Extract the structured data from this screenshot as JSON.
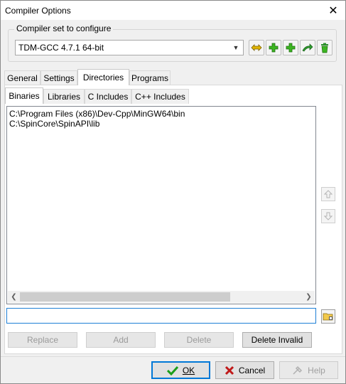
{
  "window": {
    "title": "Compiler Options",
    "close_glyph": "✕"
  },
  "compiler_group": {
    "legend": "Compiler set to configure",
    "selected": "TDM-GCC 4.7.1 64-bit",
    "icons": [
      "rename-icon",
      "add-icon",
      "add-folder-icon",
      "arrow-icon",
      "delete-icon"
    ]
  },
  "main_tabs": [
    {
      "label": "General"
    },
    {
      "label": "Settings"
    },
    {
      "label": "Directories"
    },
    {
      "label": "Programs"
    }
  ],
  "sub_tabs": [
    {
      "label": "Binaries"
    },
    {
      "label": "Libraries"
    },
    {
      "label": "C Includes"
    },
    {
      "label": "C++ Includes"
    }
  ],
  "list": {
    "items": [
      "C:\\Program Files (x86)\\Dev-Cpp\\MinGW64\\bin",
      "C:\\SpinCore\\SpinAPI\\lib"
    ]
  },
  "input": {
    "value": ""
  },
  "buttons": {
    "replace": "Replace",
    "add": "Add",
    "delete": "Delete",
    "delete_invalid": "Delete Invalid"
  },
  "dialog": {
    "ok_label": "OK",
    "cancel_label": "Cancel",
    "help_label": "Help"
  },
  "colors": {
    "accent": "#0078d7",
    "ok_check": "#1a9e1a",
    "cancel_x": "#c01818"
  }
}
